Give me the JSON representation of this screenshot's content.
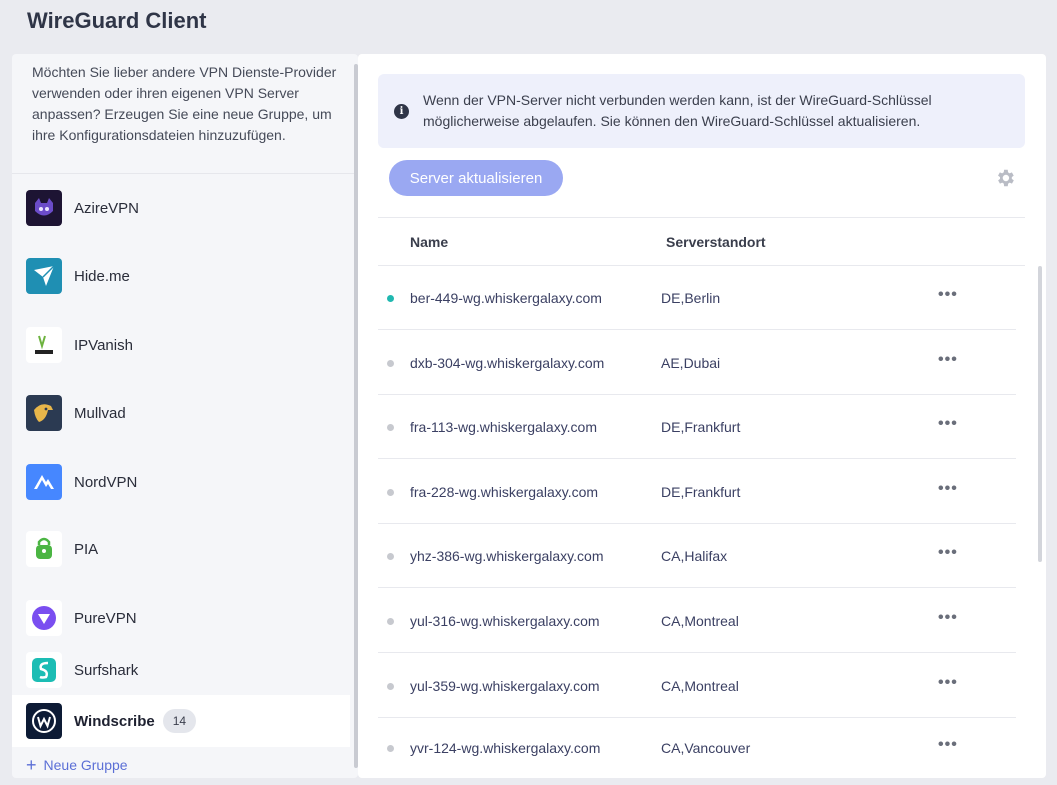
{
  "app": {
    "title": "WireGuard Client"
  },
  "sidebar": {
    "intro": "Möchten Sie lieber andere VPN Dienste-Provider verwenden oder ihren eigenen VPN Server anpassen? Erzeugen Sie eine neue Gruppe, um ihre Konfigurationsdateien hinzuzufügen.",
    "providers": [
      {
        "name": "AzireVPN",
        "icon": "azirevpn-logo-icon"
      },
      {
        "name": "Hide.me",
        "icon": "hideme-logo-icon"
      },
      {
        "name": "IPVanish",
        "icon": "ipvanish-logo-icon"
      },
      {
        "name": "Mullvad",
        "icon": "mullvad-logo-icon"
      },
      {
        "name": "NordVPN",
        "icon": "nordvpn-logo-icon"
      },
      {
        "name": "PIA",
        "icon": "pia-logo-icon"
      },
      {
        "name": "PureVPN",
        "icon": "purevpn-logo-icon"
      },
      {
        "name": "Surfshark",
        "icon": "surfshark-logo-icon"
      },
      {
        "name": "Windscribe",
        "icon": "windscribe-logo-icon",
        "badge": "14",
        "selected": true
      }
    ],
    "new_group_label": "Neue Gruppe"
  },
  "main": {
    "info_banner": "Wenn der VPN-Server nicht verbunden werden kann, ist der WireGuard-Schlüssel möglicherweise abgelaufen. Sie können den WireGuard-Schlüssel aktualisieren.",
    "update_button": "Server aktualisieren",
    "table": {
      "headers": {
        "name": "Name",
        "location": "Serverstandort"
      },
      "rows": [
        {
          "name": "ber-449-wg.whiskergalaxy.com",
          "location": "DE,Berlin",
          "status": "connected"
        },
        {
          "name": "dxb-304-wg.whiskergalaxy.com",
          "location": "AE,Dubai",
          "status": "idle"
        },
        {
          "name": "fra-113-wg.whiskergalaxy.com",
          "location": "DE,Frankfurt",
          "status": "idle"
        },
        {
          "name": "fra-228-wg.whiskergalaxy.com",
          "location": "DE,Frankfurt",
          "status": "idle"
        },
        {
          "name": "yhz-386-wg.whiskergalaxy.com",
          "location": "CA,Halifax",
          "status": "idle"
        },
        {
          "name": "yul-316-wg.whiskergalaxy.com",
          "location": "CA,Montreal",
          "status": "idle"
        },
        {
          "name": "yul-359-wg.whiskergalaxy.com",
          "location": "CA,Montreal",
          "status": "idle"
        },
        {
          "name": "yvr-124-wg.whiskergalaxy.com",
          "location": "CA,Vancouver",
          "status": "idle"
        }
      ]
    }
  },
  "colors": {
    "accent": "#9aa8f2",
    "link": "#5b6fd6",
    "connected": "#20b8b0",
    "idle": "#c7c9cf"
  }
}
